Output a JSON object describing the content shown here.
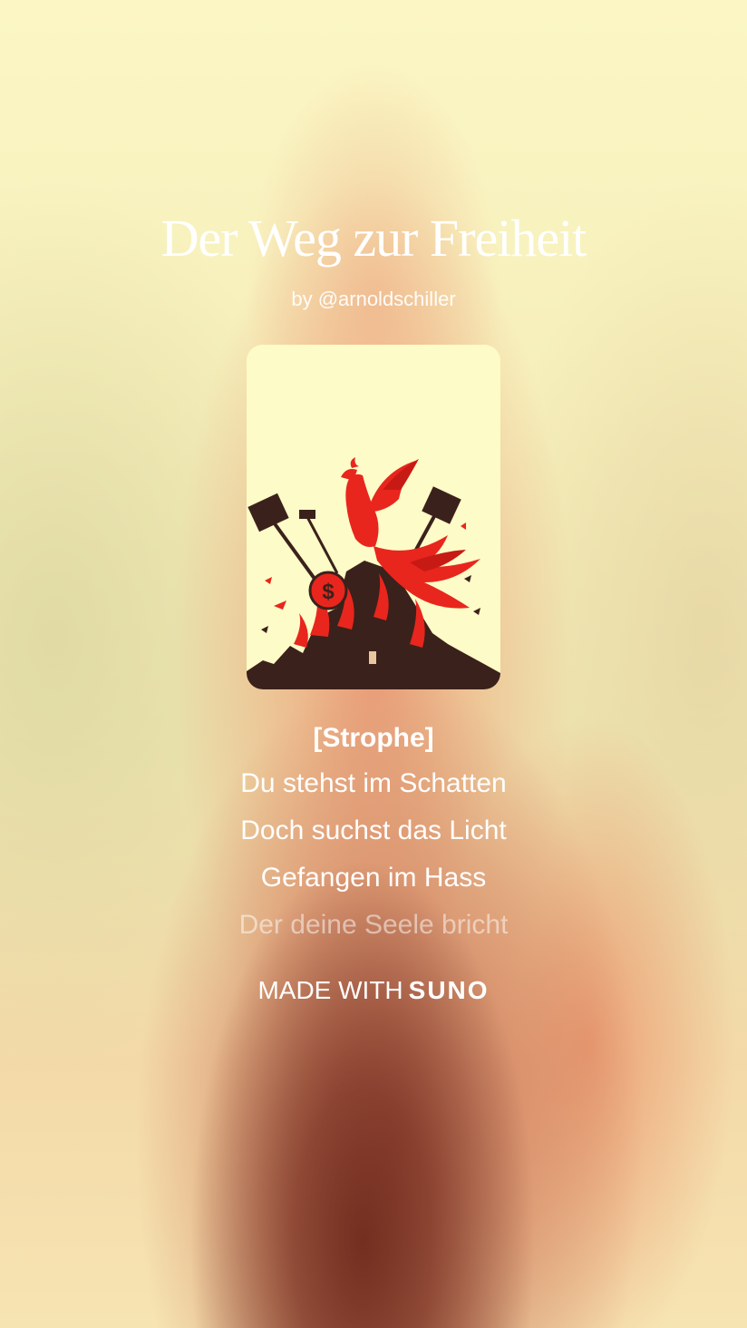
{
  "song": {
    "title": "Der Weg zur Freiheit",
    "author": "by @arnoldschiller"
  },
  "cover": {
    "icon": "phoenix-artwork",
    "colors": {
      "background": "#fdfbc7",
      "phoenix": "#e8261d",
      "rubble": "#3b211b"
    }
  },
  "lyrics": {
    "section": "[Strophe]",
    "lines": [
      "Du stehst im Schatten",
      "Doch suchst das Licht",
      "Gefangen im Hass",
      "Der deine Seele bricht"
    ]
  },
  "footer": {
    "made_with": "MADE WITH",
    "brand": "SUNO"
  }
}
